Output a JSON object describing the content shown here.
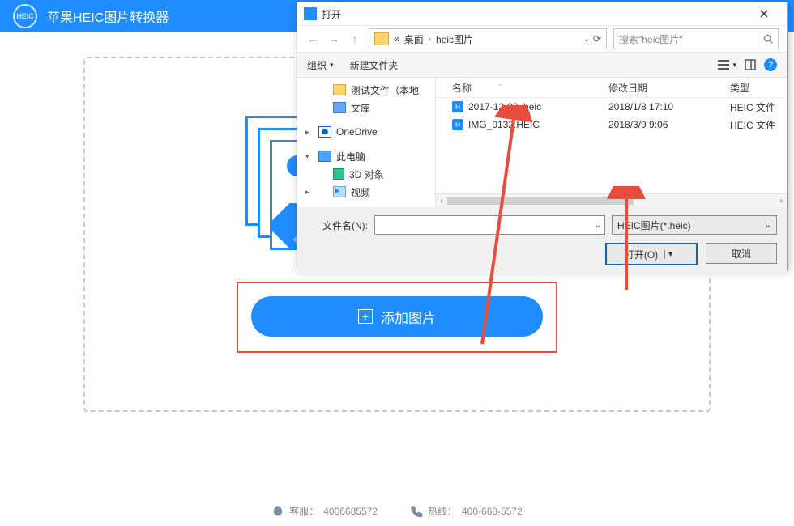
{
  "app": {
    "title": "苹果HEIC图片转换器",
    "logo_text": "HEIC"
  },
  "dropzone": {
    "add_label": "添加图片"
  },
  "footer": {
    "service_label": "客服：",
    "service_number": "4006685572",
    "hotline_label": "热线：",
    "hotline_number": "400-668-5572"
  },
  "dialog": {
    "title": "打开",
    "path_prefix": "«",
    "path_seg1": "桌面",
    "path_seg2": "heic图片",
    "search_placeholder": "搜索\"heic图片\"",
    "toolbar_organize": "组织",
    "toolbar_newfolder": "新建文件夹",
    "tree": [
      {
        "label": "测试文件（本地",
        "icon": "folder",
        "level": 2
      },
      {
        "label": "文库",
        "icon": "lib",
        "level": 2
      },
      {
        "label": "OneDrive",
        "icon": "onedrive",
        "level": 1,
        "caret": "▸",
        "spacer_before": true
      },
      {
        "label": "此电脑",
        "icon": "pc",
        "level": 1,
        "caret": "▾",
        "spacer_before": true
      },
      {
        "label": "3D 对象",
        "icon": "3d",
        "level": 2
      },
      {
        "label": "视频",
        "icon": "video",
        "level": 2,
        "caret": "▸"
      }
    ],
    "columns": {
      "name": "名称",
      "date": "修改日期",
      "type": "类型"
    },
    "files": [
      {
        "name": "2017-12-23 .heic",
        "date": "2018/1/8 17:10",
        "type": "HEIC 文件"
      },
      {
        "name": "IMG_0132.HEIC",
        "date": "2018/3/9 9:06",
        "type": "HEIC 文件"
      }
    ],
    "filename_label": "文件名(N):",
    "filename_value": "",
    "filter": "HEIC图片(*.heic)",
    "open_btn": "打开(O)",
    "cancel_btn": "取消"
  }
}
